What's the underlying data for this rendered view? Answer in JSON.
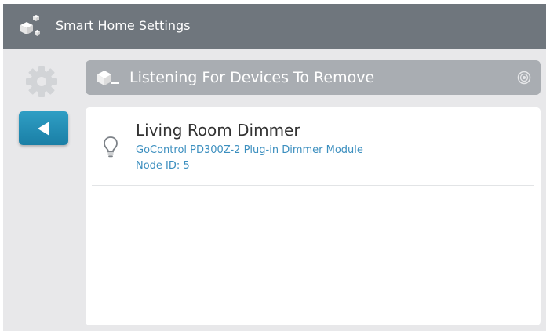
{
  "window": {
    "title": "Smart Home Settings",
    "logo_icon": "smart-home-logo-icon"
  },
  "sidebar": {
    "settings_icon": "gear-icon",
    "back_button": {
      "icon": "back-arrow-icon"
    }
  },
  "status": {
    "text": "Listening For Devices To Remove",
    "icon": "remove-device-icon",
    "indicator_icon": "target-icon"
  },
  "devices": [
    {
      "name": "Living Room Dimmer",
      "model": "GoControl PD300Z-2 Plug-in Dimmer Module",
      "node_id_label": "Node ID:",
      "node_id": "5",
      "icon": "lightbulb-icon"
    }
  ],
  "colors": {
    "title_bar": "#6f767d",
    "background": "#e8e8ea",
    "accent": "#1a8bb5",
    "link_text": "#3c8fbf",
    "status_bar": "#a9adb2"
  }
}
